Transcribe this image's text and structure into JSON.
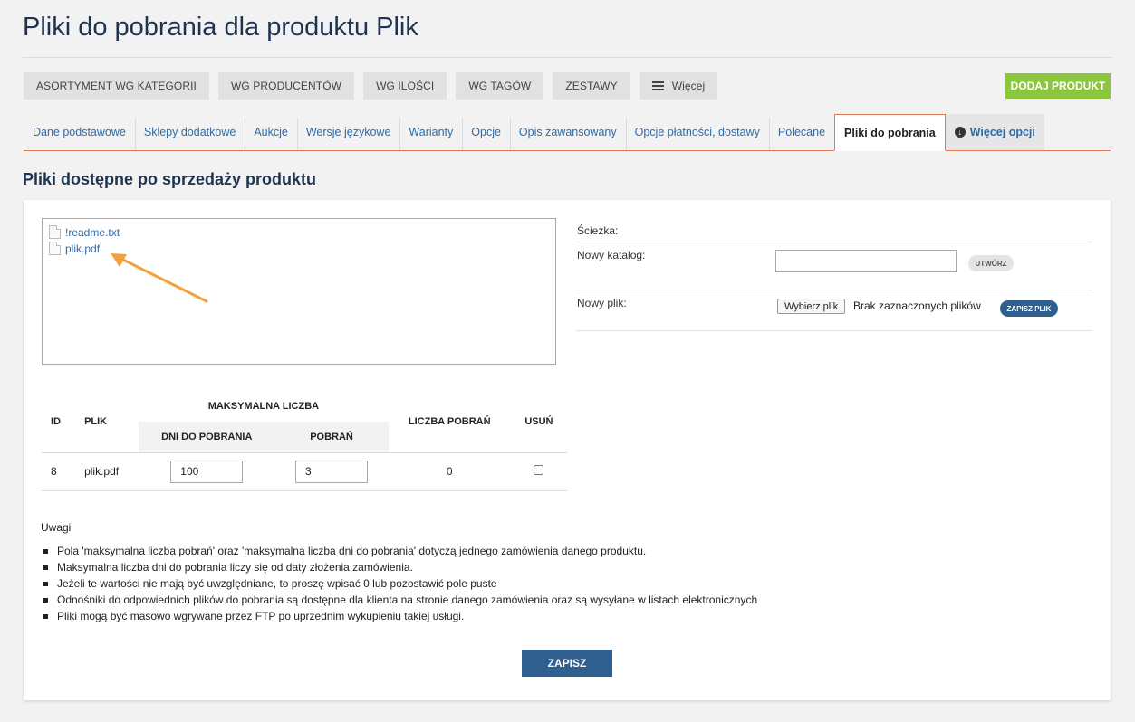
{
  "page": {
    "title": "Pliki do pobrania dla produktu Plik"
  },
  "toolbar": {
    "buttons": [
      "ASORTYMENT WG KATEGORII",
      "WG PRODUCENTÓW",
      "WG ILOŚCI",
      "WG TAGÓW",
      "ZESTAWY"
    ],
    "more_label": "Więcej",
    "add_product": "DODAJ PRODUKT"
  },
  "tabs": {
    "items": [
      "Dane podstawowe",
      "Sklepy dodatkowe",
      "Aukcje",
      "Wersje językowe",
      "Warianty",
      "Opcje",
      "Opis zawansowany",
      "Opcje płatności, dostawy",
      "Polecane",
      "Pliki do pobrania"
    ],
    "active_index": 9,
    "more_label": "Więcej opcji"
  },
  "section": {
    "title": "Pliki dostępne po sprzedaży produktu"
  },
  "file_browser": {
    "files": [
      "!readme.txt",
      "plik.pdf"
    ]
  },
  "form": {
    "path_label": "Ścieżka:",
    "new_dir_label": "Nowy katalog:",
    "new_dir_value": "",
    "create_button": "UTWÓRZ",
    "new_file_label": "Nowy plik:",
    "choose_button": "Wybierz plik",
    "no_file_text": "Brak zaznaczonych plików",
    "save_file_button": "ZAPISZ PLIK"
  },
  "table": {
    "headers": {
      "id": "ID",
      "file": "PLIK",
      "max_group": "MAKSYMALNA LICZBA",
      "days": "DNI DO POBRANIA",
      "downloads": "POBRAŃ",
      "count": "LICZBA POBRAŃ",
      "delete": "USUŃ"
    },
    "rows": [
      {
        "id": "8",
        "file": "plik.pdf",
        "days": "100",
        "downloads": "3",
        "count": "0",
        "delete": false
      }
    ]
  },
  "notes": {
    "title": "Uwagi",
    "items": [
      "Pola 'maksymalna liczba pobrań' oraz 'maksymalna liczba dni do pobrania' dotyczą jednego zamówienia danego produktu.",
      "Maksymalna liczba dni do pobrania liczy się od daty złożenia zamówienia.",
      "Jeżeli te wartości nie mają być uwzględniane, to proszę wpisać 0 lub pozostawić pole puste",
      "Odnośniki do odpowiednich plików do pobrania są dostępne dla klienta na stronie danego zamówienia oraz są wysyłane w listach elektronicznych",
      "Pliki mogą być masowo wgrywane przez FTP po uprzednim wykupieniu takiej usługi."
    ]
  },
  "save_button": "ZAPISZ",
  "colors": {
    "title": "#1f3450",
    "link": "#2e6ba8",
    "add_button": "#8cc63f",
    "primary_button": "#2f5f8f",
    "tab_border": "#e07b55",
    "annotation_arrow": "#f5a03c"
  }
}
